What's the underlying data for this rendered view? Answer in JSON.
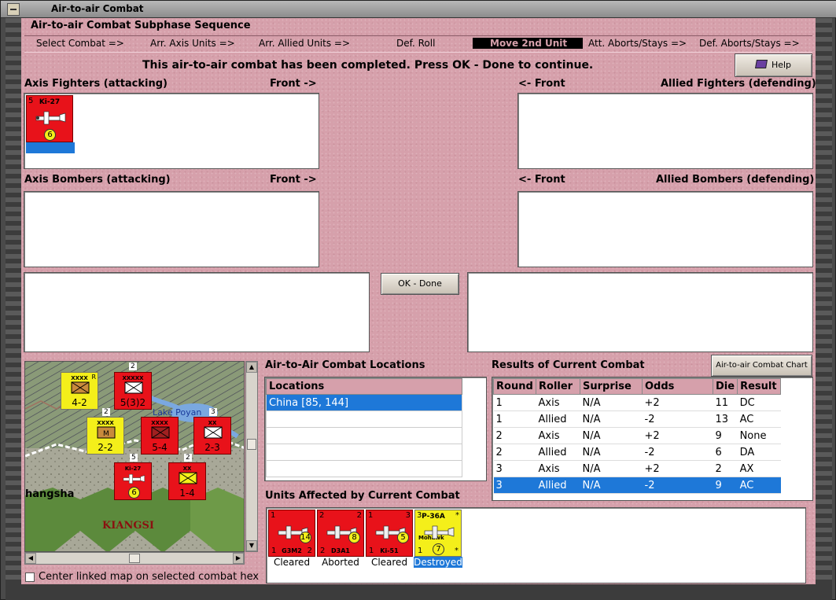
{
  "window": {
    "title": "Air-to-air Combat"
  },
  "sequence": {
    "title": "Air-to-air Combat Subphase Sequence",
    "steps": [
      {
        "label": "Select Combat =>"
      },
      {
        "label": "Arr. Axis Units =>"
      },
      {
        "label": "Arr. Allied Units =>"
      },
      {
        "label": "Def. Roll"
      },
      {
        "label": "Move 2nd Unit",
        "active": true
      },
      {
        "label": "Att. Aborts/Stays =>"
      },
      {
        "label": "Def. Aborts/Stays =>"
      }
    ]
  },
  "message": "This air-to-air combat has been completed.  Press OK - Done to continue.",
  "help_button": "Help",
  "ok_button": "OK - Done",
  "chart_button": "Air-to-air Combat Chart",
  "panels": {
    "axis_fighters": "Axis Fighters (attacking)",
    "axis_fighters_front": "Front ->",
    "allied_fighters": "Allied Fighters (defending)",
    "allied_fighters_front": "<- Front",
    "axis_bombers": "Axis Bombers (attacking)",
    "axis_bombers_front": "Front ->",
    "allied_bombers": "Allied Bombers (defending)",
    "allied_bombers_front": "<- Front"
  },
  "axis_fighter_unit": {
    "name": "Ki-27",
    "top_left": "5",
    "factor": "6"
  },
  "map": {
    "labels": {
      "city": "hangsha",
      "province": "KIANGSI",
      "lake": "Lake Poyan"
    },
    "units": [
      {
        "value": "4-2",
        "top": "XXXX",
        "side": "R"
      },
      {
        "value": "5(3)2",
        "top": "XXXXX",
        "flag": "2"
      },
      {
        "value": "2-2",
        "top": "XXXX",
        "flag": "2"
      },
      {
        "value": "5-4",
        "top": "XXXX"
      },
      {
        "value": "2-3",
        "top": "XX",
        "flag": "3"
      },
      {
        "value": "1-4",
        "top": "XX",
        "flag": "2"
      },
      {
        "value": "6",
        "name": "Ki-27",
        "flag": "5"
      }
    ]
  },
  "center_map_checkbox": "Center linked map on selected combat hex",
  "locations": {
    "title": "Air-to-Air Combat Locations",
    "header": "Locations",
    "rows": [
      "China [85, 144]"
    ]
  },
  "results": {
    "title": "Results of Current Combat",
    "headers": [
      "Round",
      "Roller",
      "Surprise",
      "Odds",
      "Die",
      "Result"
    ],
    "rows": [
      [
        "1",
        "Axis",
        "N/A",
        "+2",
        "11",
        "DC"
      ],
      [
        "1",
        "Allied",
        "N/A",
        "-2",
        "13",
        "AC"
      ],
      [
        "2",
        "Axis",
        "N/A",
        "+2",
        "9",
        "None"
      ],
      [
        "2",
        "Allied",
        "N/A",
        "-2",
        "6",
        "DA"
      ],
      [
        "3",
        "Axis",
        "N/A",
        "+2",
        "2",
        "AX"
      ],
      [
        "3",
        "Allied",
        "N/A",
        "-2",
        "9",
        "AC"
      ]
    ],
    "selected_row": 5
  },
  "affected": {
    "title": "Units Affected by Current Combat",
    "units": [
      {
        "name": "G3M2",
        "tl": "1",
        "bl": "1",
        "br": "2",
        "circle": "14",
        "status": "Cleared",
        "color": "red"
      },
      {
        "name": "D3A1",
        "tl": "2",
        "bl": "2",
        "tr": "2",
        "circle": "8",
        "status": "Aborted",
        "color": "red"
      },
      {
        "name": "Ki-51",
        "tl": "1",
        "bl": "1",
        "tr": "3",
        "circle": "5",
        "status": "Cleared",
        "color": "red"
      },
      {
        "name": "P-36A",
        "sub": "Mohawk",
        "tl": "3",
        "bl": "1",
        "tr": "*",
        "br": "*",
        "circle": "7",
        "status": "Destroyed",
        "color": "yellow"
      }
    ]
  },
  "colors": {
    "panel_bg": "#d6a0ab",
    "selection": "#1e78d8",
    "axis_red": "#e8121a",
    "allied_yellow": "#f4ef1a"
  }
}
